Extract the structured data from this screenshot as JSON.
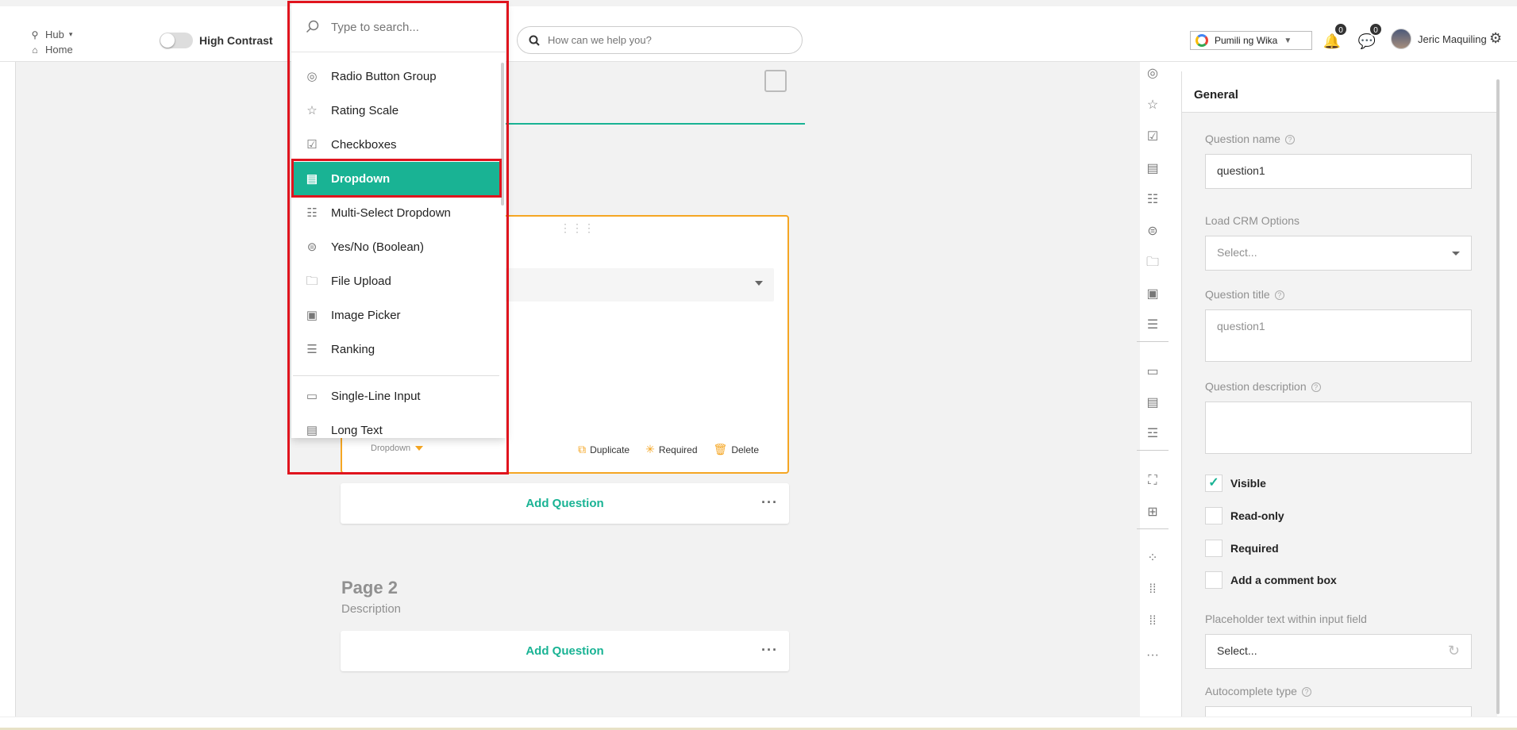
{
  "header": {
    "nav_hub": "Hub",
    "nav_home": "Home",
    "contrast_label": "High Contrast",
    "help_search_placeholder": "How can we help you?",
    "translate_label": "Pumili ng Wika",
    "notifications_count": "0",
    "messages_count": "0",
    "user_name": "Jeric Maquiling"
  },
  "dropdown_menu": {
    "search_placeholder": "Type to search...",
    "items": [
      {
        "label": "Radio Button Group",
        "icon": "radio-icon"
      },
      {
        "label": "Rating Scale",
        "icon": "star-icon"
      },
      {
        "label": "Checkboxes",
        "icon": "checkbox-icon"
      },
      {
        "label": "Dropdown",
        "icon": "dropdown-icon",
        "selected": true
      },
      {
        "label": "Multi-Select Dropdown",
        "icon": "multiselect-icon"
      },
      {
        "label": "Yes/No (Boolean)",
        "icon": "boolean-icon"
      },
      {
        "label": "File Upload",
        "icon": "folder-icon"
      },
      {
        "label": "Image Picker",
        "icon": "image-picker-icon"
      },
      {
        "label": "Ranking",
        "icon": "ranking-icon"
      },
      {
        "label": "Single-Line Input",
        "icon": "text-input-icon"
      },
      {
        "label": "Long Text",
        "icon": "long-text-icon"
      }
    ]
  },
  "question_card": {
    "type_label": "Dropdown",
    "duplicate": "Duplicate",
    "required": "Required",
    "delete": "Delete"
  },
  "add_question": "Add Question",
  "page2": {
    "title": "Page 2",
    "description": "Description"
  },
  "properties": {
    "tab": "General",
    "question_name_label": "Question name",
    "question_name_value": "question1",
    "load_crm_label": "Load CRM Options",
    "load_crm_placeholder": "Select...",
    "question_title_label": "Question title",
    "question_title_placeholder": "question1",
    "question_desc_label": "Question description",
    "visible": "Visible",
    "read_only": "Read-only",
    "required": "Required",
    "comment_box": "Add a comment box",
    "placeholder_label": "Placeholder text within input field",
    "placeholder_value": "Select...",
    "autocomplete_label": "Autocomplete type"
  },
  "colors": {
    "accent": "#19b394",
    "selection_highlight": "#e0141e",
    "card_border": "#f5a623"
  }
}
